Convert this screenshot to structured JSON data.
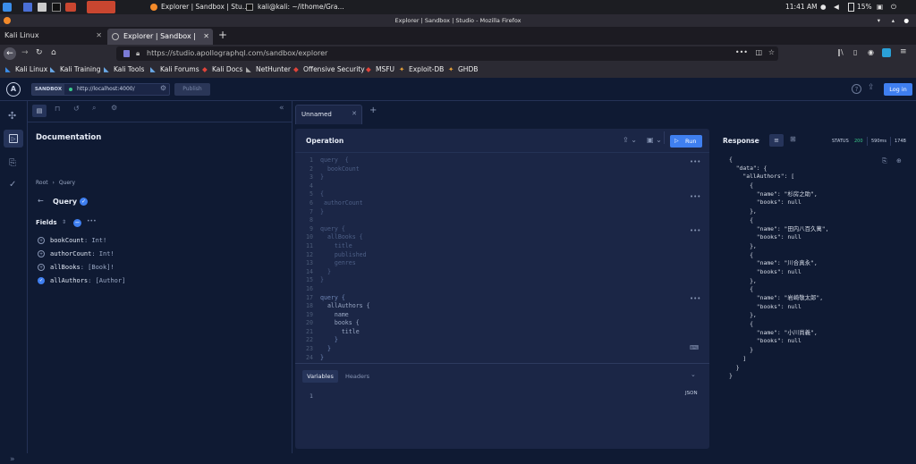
{
  "taskbar": {
    "task_firefox": "Explorer | Sandbox | Stu...",
    "task_terminal": "kali@kali: ~/ithome/Gra...",
    "clock": "11:41 AM",
    "battery": "15%"
  },
  "window_title": "Explorer | Sandbox | Studio - Mozilla Firefox",
  "tabs": [
    {
      "label": "Kali Linux"
    },
    {
      "label": "Explorer | Sandbox | Studi"
    }
  ],
  "url": "https://studio.apollographql.com/sandbox/explorer",
  "bookmarks": [
    "Kali Linux",
    "Kali Training",
    "Kali Tools",
    "Kali Forums",
    "Kali Docs",
    "NetHunter",
    "Offensive Security",
    "MSFU",
    "Exploit-DB",
    "GHDB"
  ],
  "header": {
    "sandbox_label": "SANDBOX",
    "endpoint": "http://localhost:4000/",
    "publish": "Publish",
    "login": "Log in"
  },
  "docs": {
    "title": "Documentation",
    "crumb_root": "Root",
    "crumb_sep": "›",
    "crumb_current": "Query",
    "type_name": "Query",
    "fields_label": "Fields",
    "fields": [
      {
        "name": "bookCount",
        "type": ": Int!"
      },
      {
        "name": "authorCount",
        "type": ": Int!"
      },
      {
        "name": "allBooks",
        "type": ": [Book]!"
      },
      {
        "name": "allAuthors",
        "type": ": [Author]"
      }
    ]
  },
  "tab_unnamed": "Unnamed",
  "operation": {
    "title": "Operation",
    "run": "Run",
    "lines": [
      {
        "n": "1",
        "t": "query  {"
      },
      {
        "n": "2",
        "t": "  bookCount"
      },
      {
        "n": "3",
        "t": "}"
      },
      {
        "n": "4",
        "t": ""
      },
      {
        "n": "5",
        "t": "{"
      },
      {
        "n": "6",
        "t": " authorCount"
      },
      {
        "n": "7",
        "t": "}"
      },
      {
        "n": "8",
        "t": ""
      },
      {
        "n": "9",
        "t": "query {"
      },
      {
        "n": "10",
        "t": "  allBooks {"
      },
      {
        "n": "11",
        "t": "    title"
      },
      {
        "n": "12",
        "t": "    published"
      },
      {
        "n": "13",
        "t": "    genres"
      },
      {
        "n": "14",
        "t": "  }"
      },
      {
        "n": "15",
        "t": "}"
      },
      {
        "n": "16",
        "t": ""
      },
      {
        "n": "17",
        "t": "query {"
      },
      {
        "n": "18",
        "t": "  allAuthors {"
      },
      {
        "n": "19",
        "t": "    name"
      },
      {
        "n": "20",
        "t": "    books {"
      },
      {
        "n": "21",
        "t": "      title"
      },
      {
        "n": "22",
        "t": "    }"
      },
      {
        "n": "23",
        "t": "  }"
      },
      {
        "n": "24",
        "t": "}"
      }
    ],
    "tab_variables": "Variables",
    "tab_headers": "Headers",
    "var_line": "1",
    "json_label": "JSON"
  },
  "response": {
    "title": "Response",
    "status_label": "STATUS",
    "status_code": "200",
    "time": "590ms",
    "size": "174B",
    "lines": [
      "{",
      "  \"data\": {",
      "    \"allAuthors\": [",
      "      {",
      "        \"name\": \"杉房之助\",",
      "        \"books\": null",
      "      },",
      "      {",
      "        \"name\": \"田内八百久萬\",",
      "        \"books\": null",
      "      },",
      "      {",
      "        \"name\": \"川合真永\",",
      "        \"books\": null",
      "      },",
      "      {",
      "        \"name\": \"岩崎敬太郎\",",
      "        \"books\": null",
      "      },",
      "      {",
      "        \"name\": \"小川尚義\",",
      "        \"books\": null",
      "      }",
      "    ]",
      "  }",
      "}"
    ]
  },
  "colors": {
    "accent": "#3f7ff0",
    "status_green": "#39c98a",
    "bg": "#0f1a33",
    "panel": "#1b2646"
  }
}
